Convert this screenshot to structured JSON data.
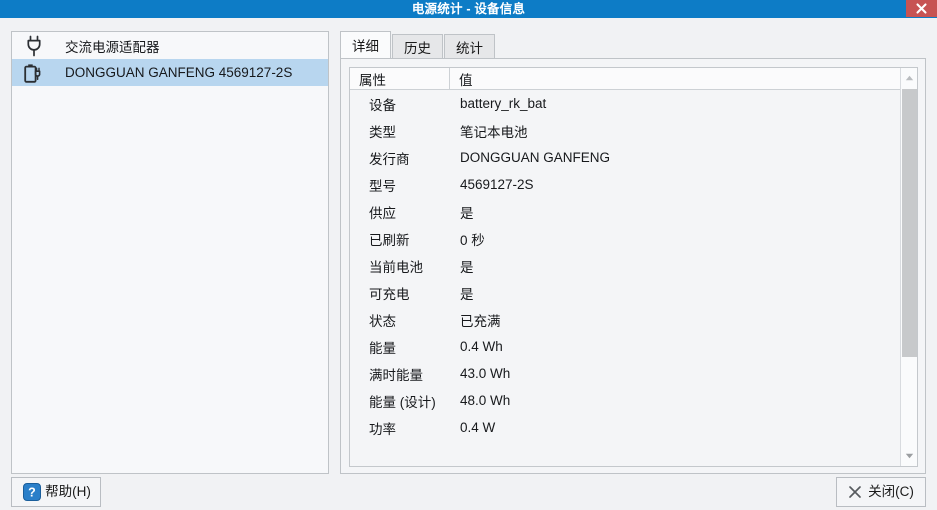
{
  "window": {
    "title": "电源统计 - 设备信息",
    "close_icon": "close-x-icon",
    "titlebar_color": "#0d7cc6",
    "close_button_color": "#c75353"
  },
  "device_list": {
    "items": [
      {
        "label": "交流电源适配器",
        "icon": "ac-adapter-plug-icon",
        "selected": false
      },
      {
        "label": "DONGGUAN GANFENG 4569127-2S",
        "icon": "battery-charging-icon",
        "selected": true
      }
    ],
    "selection_color": "#b8d6ef"
  },
  "tabs": [
    {
      "label": "详细",
      "active": true
    },
    {
      "label": "历史",
      "active": false
    },
    {
      "label": "统计",
      "active": false
    }
  ],
  "table": {
    "columns": [
      "属性",
      "值"
    ],
    "rows": [
      {
        "attribute": "设备",
        "value": "battery_rk_bat"
      },
      {
        "attribute": "类型",
        "value": "笔记本电池"
      },
      {
        "attribute": "发行商",
        "value": "DONGGUAN GANFENG"
      },
      {
        "attribute": "型号",
        "value": "4569127-2S"
      },
      {
        "attribute": "供应",
        "value": "是"
      },
      {
        "attribute": "已刷新",
        "value": "0 秒"
      },
      {
        "attribute": "当前电池",
        "value": "是"
      },
      {
        "attribute": "可充电",
        "value": "是"
      },
      {
        "attribute": "状态",
        "value": "已充满"
      },
      {
        "attribute": "能量",
        "value": "0.4 Wh"
      },
      {
        "attribute": "满时能量",
        "value": "43.0 Wh"
      },
      {
        "attribute": "能量 (设计)",
        "value": "48.0 Wh"
      },
      {
        "attribute": "功率",
        "value": "0.4 W"
      }
    ]
  },
  "scrollbar": {
    "up_icon": "scroll-up-arrow-icon",
    "down_icon": "scroll-down-arrow-icon"
  },
  "buttons": {
    "help": {
      "label": "帮助(H)",
      "icon": "question-mark-icon"
    },
    "close": {
      "label": "关闭(C)",
      "icon": "close-x-icon"
    }
  }
}
